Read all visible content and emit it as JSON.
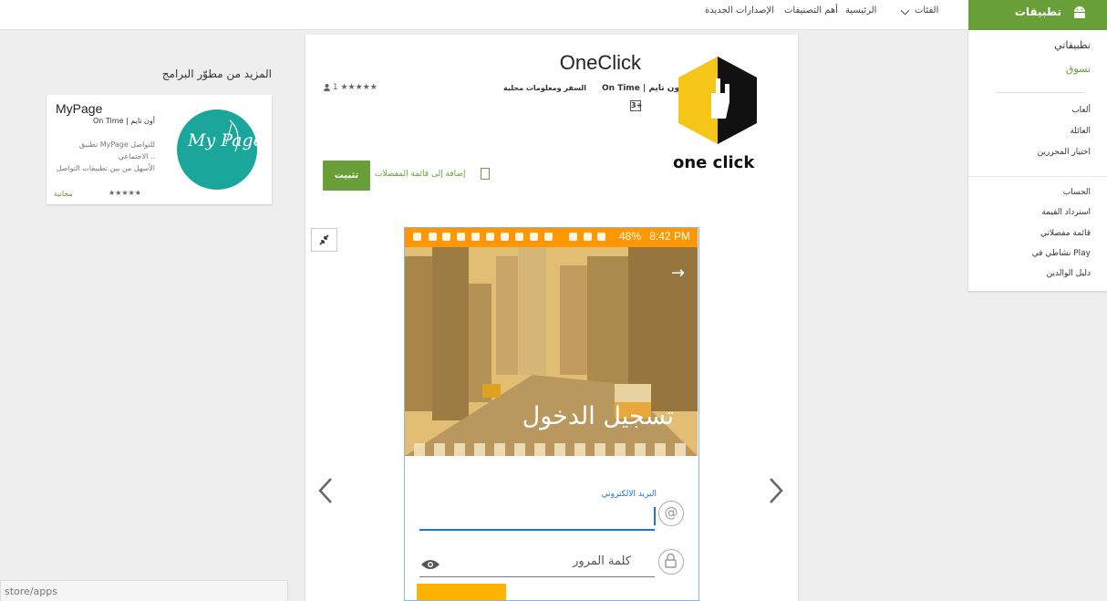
{
  "topbar": {
    "apps_tab": "تطبيقات",
    "nav": [
      "الفئات",
      "الرئيسية",
      "أهم التصنيفات",
      "الإصدارات الجديدة"
    ]
  },
  "sidebar": {
    "my_apps": "تطبيقاتي",
    "shop": "تسوق",
    "group1": [
      "ألعاب",
      "العائلة",
      "اختيار المحررين"
    ],
    "group2": [
      "الحساب",
      "استرداد القيمة",
      "قائمة مفضلاتي",
      "نشاطي في Play",
      "دليل الوالدين"
    ]
  },
  "app": {
    "title": "OneClick",
    "developer": "On Time | أون تايم",
    "category": "السفر ومعلومات محلية",
    "content_rating": "3+",
    "stars": "★★★★★",
    "reviews": "1",
    "install": "تثبيت",
    "wishlist": "إضافة إلى قائمة المفضلات",
    "logo_text": "one click"
  },
  "screenshot": {
    "status_time": "8:42 PM",
    "status_battery": "48%",
    "hero_title": "تسجيل الدخول",
    "email_label": "البريد الالكتروني",
    "password_label": "كلمة المرور"
  },
  "more": {
    "title": "المزيد من مطوّر البرامج",
    "card": {
      "name": "MyPage",
      "developer": "On Time | أون تايم",
      "desc1": "تطبيق MyPage للتواصل",
      "desc2": "الاجتماعي ..",
      "desc3": "الأسهل من بين تطبيقات التواصل",
      "stars": "★★★★★",
      "price": "مجانية",
      "logo_text": "My Page"
    }
  },
  "url": "store/apps",
  "colors": {
    "green": "#689f38",
    "orange": "#ff9800",
    "blue": "#1976d2",
    "logo_yellow": "#f5c518"
  }
}
